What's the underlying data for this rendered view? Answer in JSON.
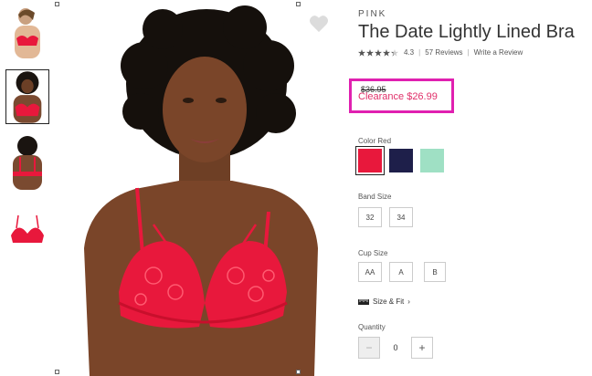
{
  "product": {
    "brand": "PINK",
    "title": "The Date Lightly Lined Bra",
    "rating": "4.3",
    "rating_stars": 4.3,
    "reviews_link": "57 Reviews",
    "write_review_link": "Write a Review",
    "original_price": "$36.95",
    "clearance_price": "Clearance $26.99"
  },
  "color": {
    "label": "Color Red",
    "swatches": [
      {
        "name": "Red",
        "hex": "#e8183c",
        "selected": true
      },
      {
        "name": "Navy",
        "hex": "#1e1f4a",
        "selected": false
      },
      {
        "name": "Mint",
        "hex": "#9fe0c4",
        "selected": false
      }
    ]
  },
  "band_size": {
    "label": "Band Size",
    "options": [
      "32",
      "34"
    ]
  },
  "cup_size": {
    "label": "Cup Size",
    "options": [
      "AA",
      "A",
      "B"
    ]
  },
  "size_fit": {
    "icon": "ruler-icon",
    "label": "Size & Fit",
    "chevron": "›"
  },
  "quantity": {
    "label": "Quantity",
    "value": "0",
    "decrement": "−",
    "increment": "+"
  },
  "colors": {
    "accent_pink": "#e0306a",
    "highlight_magenta": "#e020b0",
    "product_red": "#e8183c"
  }
}
